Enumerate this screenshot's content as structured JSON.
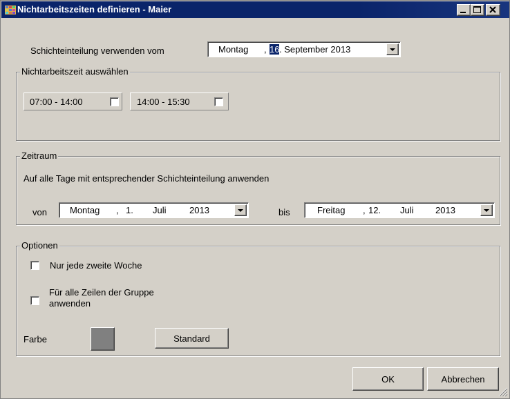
{
  "window": {
    "title": "Nichtarbeitszeiten definieren - Maier",
    "controls": [
      "minimize-icon",
      "maximize-icon",
      "close-icon"
    ]
  },
  "schedule": {
    "label": "Schichteinteilung verwenden vom",
    "date": {
      "weekday": "Montag",
      "sep": ",",
      "day": "16",
      "rest": ". September 2013"
    }
  },
  "nonwork": {
    "legend": "Nichtarbeitszeit  auswählen",
    "slots": [
      {
        "label": "07:00 - 14:00",
        "checked": false
      },
      {
        "label": "14:00 - 15:30",
        "checked": false
      }
    ]
  },
  "period": {
    "legend": "Zeitraum",
    "description": "Auf alle Tage mit entsprechender Schichteinteilung anwenden",
    "from_label": "von",
    "from": {
      "weekday": "Montag",
      "sep": ",",
      "day": "1.",
      "month": "Juli",
      "year": "2013"
    },
    "to_label": "bis",
    "to": {
      "weekday": "Freitag",
      "sep": ",",
      "day": "12.",
      "month": "Juli",
      "year": "2013"
    }
  },
  "options": {
    "legend": "Optionen",
    "every_second_week": "Nur jede zweite Woche",
    "all_rows_line1": "Für alle Zeilen der Gruppe",
    "all_rows_line2": "anwenden",
    "color_label": "Farbe",
    "color_value": "#808080",
    "standard_button": "Standard"
  },
  "footer": {
    "ok": "OK",
    "cancel": "Abbrechen"
  }
}
